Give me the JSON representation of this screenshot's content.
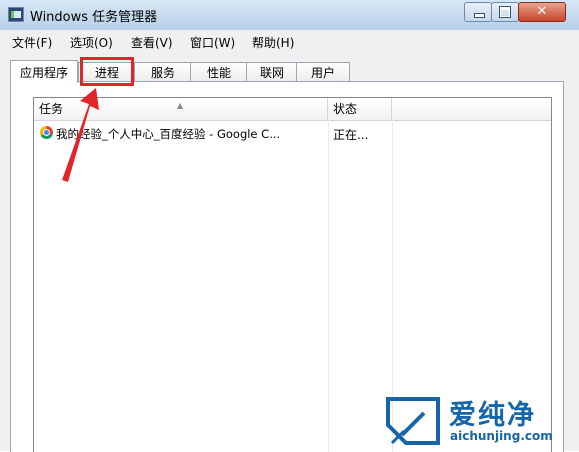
{
  "window": {
    "title": "Windows 任务管理器",
    "close_glyph": "✕"
  },
  "menu": {
    "items": [
      "文件(F)",
      "选项(O)",
      "查看(V)",
      "窗口(W)",
      "帮助(H)"
    ]
  },
  "tabs": {
    "items": [
      "应用程序",
      "进程",
      "服务",
      "性能",
      "联网",
      "用户"
    ],
    "active": "应用程序",
    "highlighted": "进程"
  },
  "list": {
    "columns": [
      "任务",
      "状态"
    ],
    "rows": [
      {
        "icon": "chrome-icon",
        "task": "我的经验_个人中心_百度经验 - Google C...",
        "status": "正在..."
      }
    ]
  },
  "watermark": {
    "name": "爱纯净",
    "url": "aichunjing.com"
  },
  "colors": {
    "annotation": "#e0262b",
    "watermark": "#1565a8"
  }
}
